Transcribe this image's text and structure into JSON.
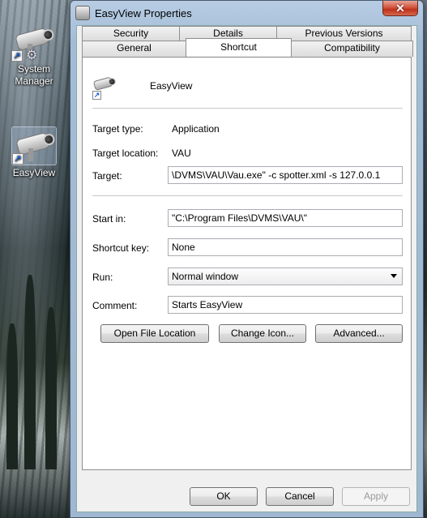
{
  "desktop": {
    "icons": [
      {
        "label": "System Manager"
      },
      {
        "label": "EasyView"
      }
    ]
  },
  "window": {
    "title": "EasyView Properties",
    "close_glyph": "✕",
    "tabs_row1": [
      "Security",
      "Details",
      "Previous Versions"
    ],
    "tabs_row2": [
      "General",
      "Shortcut",
      "Compatibility"
    ],
    "active_tab": "Shortcut"
  },
  "shortcut": {
    "name": "EasyView",
    "target_type_label": "Target type:",
    "target_type_value": "Application",
    "target_location_label": "Target location:",
    "target_location_value": "VAU",
    "target_label": "Target:",
    "target_value": "\\DVMS\\VAU\\Vau.exe\" -c spotter.xml -s 127.0.0.1",
    "start_in_label": "Start in:",
    "start_in_value": "\"C:\\Program Files\\DVMS\\VAU\\\"",
    "shortcut_key_label": "Shortcut key:",
    "shortcut_key_value": "None",
    "run_label": "Run:",
    "run_value": "Normal window",
    "comment_label": "Comment:",
    "comment_value": "Starts EasyView",
    "open_file_location": "Open File Location",
    "change_icon": "Change Icon...",
    "advanced": "Advanced..."
  },
  "footer": {
    "ok": "OK",
    "cancel": "Cancel",
    "apply": "Apply"
  },
  "icons": {
    "title": "camera-icon",
    "shortcut": "shortcut-arrow-icon"
  }
}
